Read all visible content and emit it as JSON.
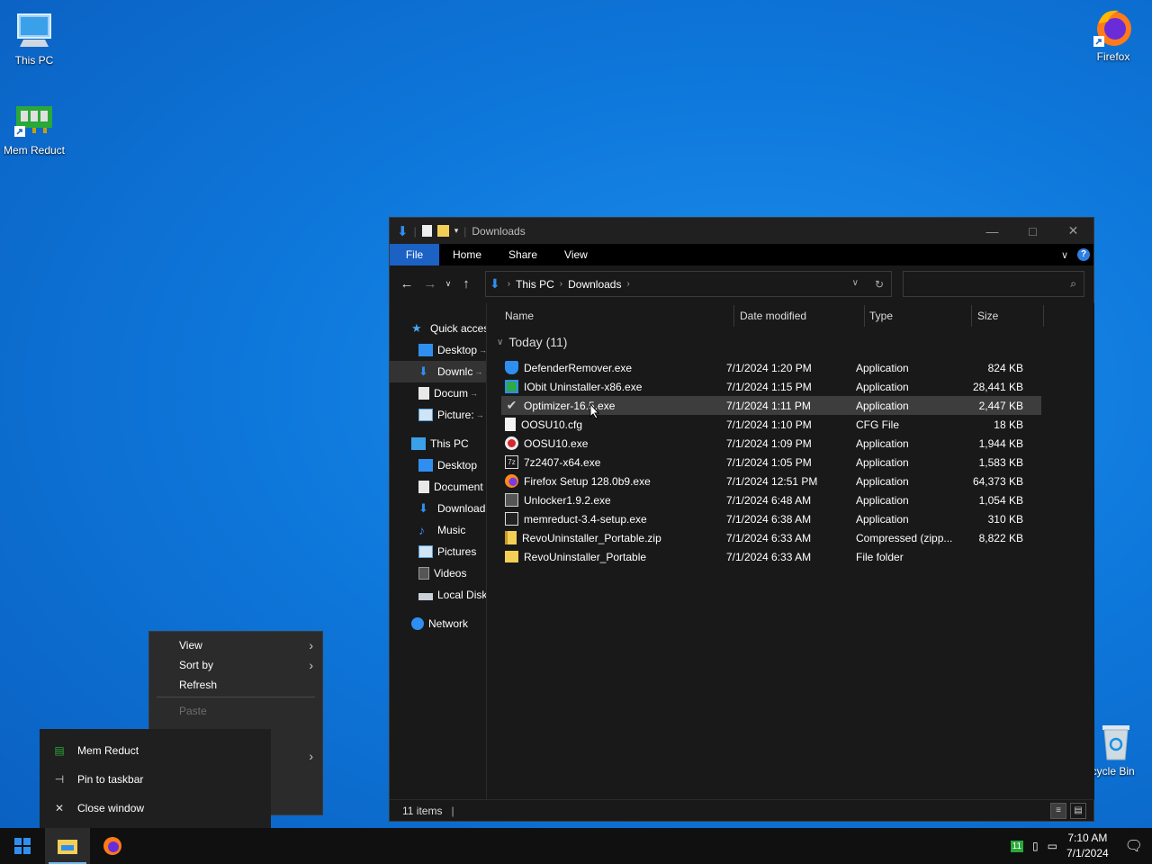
{
  "desktop": {
    "icons": [
      {
        "label": "This PC"
      },
      {
        "label": "Mem Reduct"
      },
      {
        "label": "Firefox"
      },
      {
        "label": "ecycle Bin"
      }
    ]
  },
  "explorer": {
    "title": "Downloads",
    "ribbon_tabs": [
      "File",
      "Home",
      "Share",
      "View"
    ],
    "breadcrumb": [
      "This PC",
      "Downloads"
    ],
    "search_placeholder": "",
    "sidebar": {
      "quick_access": "Quick acces",
      "pinned": [
        "Desktop",
        "Downlc",
        "Docum",
        "Picture:"
      ],
      "this_pc": "This PC",
      "pc_items": [
        "Desktop",
        "Document",
        "Download",
        "Music",
        "Pictures",
        "Videos",
        "Local Disk"
      ],
      "network": "Network"
    },
    "columns": {
      "name": "Name",
      "date": "Date modified",
      "type": "Type",
      "size": "Size"
    },
    "group": "Today (11)",
    "files": [
      {
        "name": "DefenderRemover.exe",
        "date": "7/1/2024 1:20 PM",
        "type": "Application",
        "size": "824 KB",
        "icon": "shield-icon"
      },
      {
        "name": "IObit Uninstaller-x86.exe",
        "date": "7/1/2024 1:15 PM",
        "type": "Application",
        "size": "28,441 KB",
        "icon": "iobit-icon"
      },
      {
        "name": "Optimizer-16.5.exe",
        "date": "7/1/2024 1:11 PM",
        "type": "Application",
        "size": "2,447 KB",
        "icon": "check-icon"
      },
      {
        "name": "OOSU10.cfg",
        "date": "7/1/2024 1:10 PM",
        "type": "CFG File",
        "size": "18 KB",
        "icon": "file-icon"
      },
      {
        "name": "OOSU10.exe",
        "date": "7/1/2024 1:09 PM",
        "type": "Application",
        "size": "1,944 KB",
        "icon": "oosu-icon"
      },
      {
        "name": "7z2407-x64.exe",
        "date": "7/1/2024 1:05 PM",
        "type": "Application",
        "size": "1,583 KB",
        "icon": "7zip-icon"
      },
      {
        "name": "Firefox Setup 128.0b9.exe",
        "date": "7/1/2024 12:51 PM",
        "type": "Application",
        "size": "64,373 KB",
        "icon": "firefox-icon"
      },
      {
        "name": "Unlocker1.9.2.exe",
        "date": "7/1/2024 6:48 AM",
        "type": "Application",
        "size": "1,054 KB",
        "icon": "unlocker-icon"
      },
      {
        "name": "memreduct-3.4-setup.exe",
        "date": "7/1/2024 6:38 AM",
        "type": "Application",
        "size": "310 KB",
        "icon": "installer-icon"
      },
      {
        "name": "RevoUninstaller_Portable.zip",
        "date": "7/1/2024 6:33 AM",
        "type": "Compressed (zipp...",
        "size": "8,822 KB",
        "icon": "zip-icon"
      },
      {
        "name": "RevoUninstaller_Portable",
        "date": "7/1/2024 6:33 AM",
        "type": "File folder",
        "size": "",
        "icon": "folder-icon"
      }
    ],
    "status": "11 items"
  },
  "context_menu": {
    "items": [
      "View",
      "Sort by",
      "Refresh",
      "Paste"
    ]
  },
  "jump_list": {
    "items": [
      "Mem Reduct",
      "Pin to taskbar",
      "Close window"
    ]
  },
  "taskbar": {
    "time": "7:10 AM",
    "date": "7/1/2024",
    "tray_badge": "11"
  },
  "colors": {
    "accent": "#1b62c4",
    "selection": "#3d3d3d",
    "window_bg": "#191919"
  }
}
